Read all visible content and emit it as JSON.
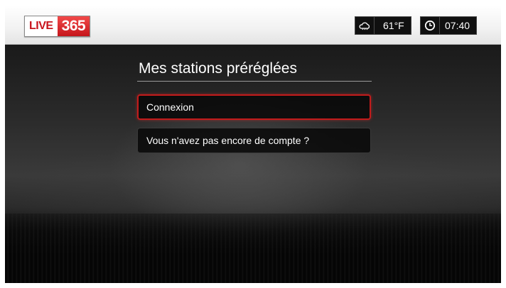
{
  "header": {
    "logo": {
      "left_text": "LIVE",
      "right_text": "365"
    },
    "weather": {
      "icon": "weather-cloud-icon",
      "temperature": "61°F"
    },
    "clock": {
      "icon": "clock-icon",
      "time": "07:40"
    }
  },
  "main": {
    "title": "Mes stations préréglées",
    "menu": [
      {
        "label": "Connexion",
        "selected": true
      },
      {
        "label": "Vous n'avez pas encore de compte ?",
        "selected": false
      }
    ]
  },
  "colors": {
    "accent": "#c21b1b",
    "logo_red": "#c8141c"
  }
}
